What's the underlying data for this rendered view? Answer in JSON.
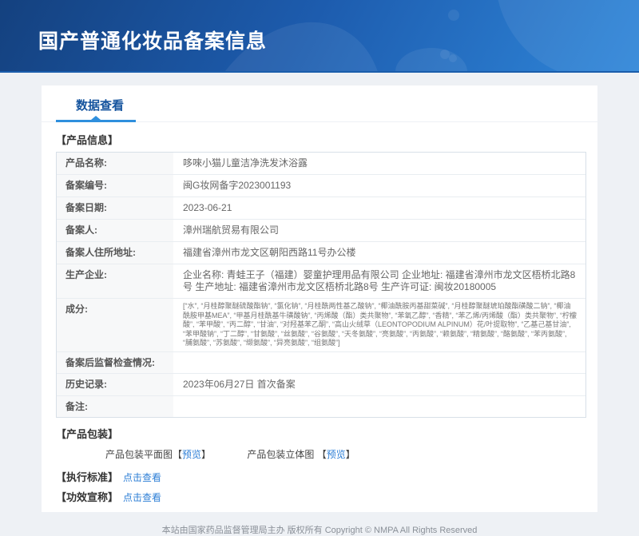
{
  "banner": {
    "title": "国产普通化妆品备案信息"
  },
  "tabs": {
    "data_view": "数据查看"
  },
  "product_info": {
    "section_title": "【产品信息】",
    "rows": [
      {
        "label": "产品名称:",
        "value": "哆唻小猫儿童洁净洗发沐浴露"
      },
      {
        "label": "备案编号:",
        "value": "闽G妆网备字2023001193"
      },
      {
        "label": "备案日期:",
        "value": "2023-06-21"
      },
      {
        "label": "备案人:",
        "value": "漳州瑞航贸易有限公司"
      },
      {
        "label": "备案人住所地址:",
        "value": "福建省漳州市龙文区朝阳西路11号办公楼"
      },
      {
        "label": "生产企业:",
        "value": "企业名称: 青蛙王子（福建）婴童护理用品有限公司 企业地址: 福建省漳州市龙文区梧桥北路8号 生产地址: 福建省漳州市龙文区梧桥北路8号 生产许可证: 闽妆20180005"
      },
      {
        "label": "成分:",
        "value": "[“水”, “月桂醇聚醚硫酸酯钠”, “氯化钠”, “月桂酰两性基乙酸钠”, “椰油酰胺丙基甜菜碱”, “月桂醇聚醚琥珀酸酯磺酸二钠”, “椰油酰胺甲基MEA”, “甲基月桂酰基牛磺酸钠”, “丙烯酸（酯）类共聚物”, “苯氧乙醇”, “香精”, “苯乙烯/丙烯酸（酯）类共聚物”, “柠檬酸”, “苯甲酸”, “丙二醇”, “甘油”, “对羟基苯乙酮”, “高山火绒草（LEONTOPODIUM ALPINUM）花/叶提取物”, “乙基己基甘油”, “苯甲酸钠”, “丁二醇”, “甘氨酸”, “丝氨酸”, “谷氨酸”, “天冬氨酸”, “亮氨酸”, “丙氨酸”, “赖氨酸”, “精氨酸”, “酪氨酸”, “苯丙氨酸”, “脯氨酸”, “苏氨酸”, “缬氨酸”, “异亮氨酸”, “组氨酸”]"
      },
      {
        "label": "备案后监督检查情况:",
        "value": ""
      },
      {
        "label": "历史记录:",
        "value": "2023年06月27日 首次备案"
      },
      {
        "label": "备注:",
        "value": ""
      }
    ]
  },
  "packaging": {
    "section_title": "【产品包装】",
    "flat_label": "产品包装平面图",
    "stereo_label": "产品包装立体图",
    "bracket_open": "【",
    "preview_link": "预览",
    "bracket_close": "】"
  },
  "standard": {
    "label": "【执行标准】",
    "link": "点击查看"
  },
  "efficacy": {
    "label": "【功效宣称】",
    "link": "点击查看"
  },
  "footer": {
    "text": "本站由国家药品监督管理局主办 版权所有 Copyright © NMPA All Rights Reserved"
  },
  "colors": {
    "page-bg": "#eef1f5",
    "banner-start": "#14417f",
    "banner-end": "#2f86d9",
    "accent": "#2f8fdd",
    "tab-text": "#15549e",
    "link": "#2e7fd6",
    "label-bg": "#f7f8f9",
    "border": "#d8e0e8"
  }
}
